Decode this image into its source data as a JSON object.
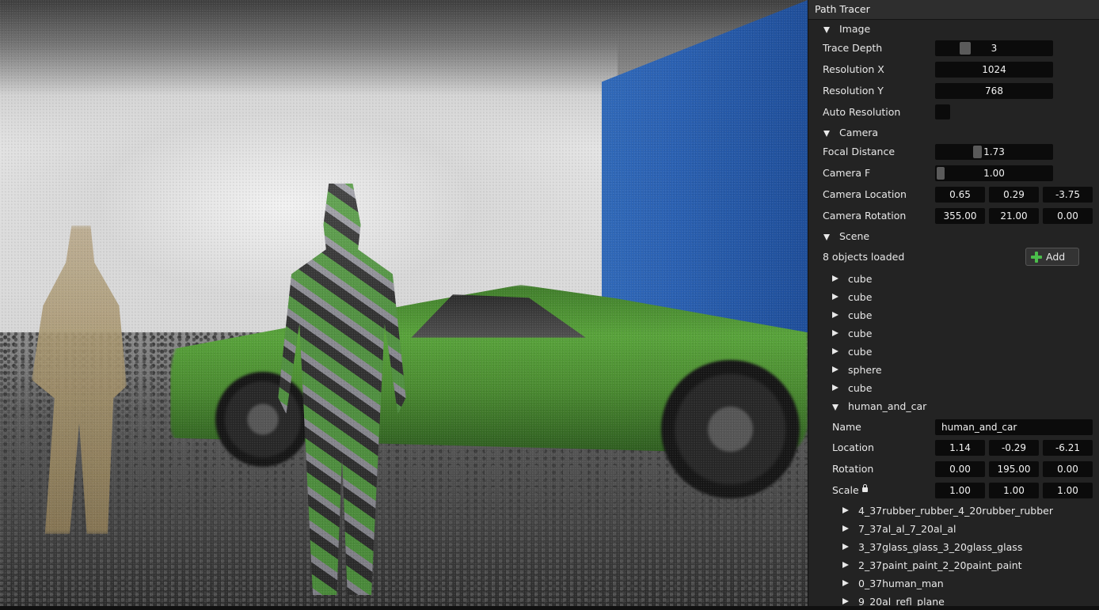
{
  "panel": {
    "title": "Path Tracer",
    "image": {
      "header": "Image",
      "trace_depth": {
        "label": "Trace Depth",
        "value": "3"
      },
      "resolution_x": {
        "label": "Resolution X",
        "value": "1024"
      },
      "resolution_y": {
        "label": "Resolution Y",
        "value": "768"
      },
      "auto_resolution": {
        "label": "Auto Resolution",
        "checked": false
      }
    },
    "camera": {
      "header": "Camera",
      "focal_distance": {
        "label": "Focal Distance",
        "value": "1.73"
      },
      "camera_f": {
        "label": "Camera F",
        "value": "1.00"
      },
      "location": {
        "label": "Camera Location",
        "values": [
          "0.65",
          "0.29",
          "-3.75"
        ]
      },
      "rotation": {
        "label": "Camera Rotation",
        "values": [
          "355.00",
          "21.00",
          "0.00"
        ]
      }
    },
    "scene": {
      "header": "Scene",
      "status": "8 objects loaded",
      "add_label": "Add",
      "objects": [
        "cube",
        "cube",
        "cube",
        "cube",
        "cube",
        "sphere",
        "cube"
      ],
      "expanded": {
        "label": "human_and_car",
        "name": {
          "label": "Name",
          "value": "human_and_car"
        },
        "location": {
          "label": "Location",
          "values": [
            "1.14",
            "-0.29",
            "-6.21"
          ]
        },
        "rotation": {
          "label": "Rotation",
          "values": [
            "0.00",
            "195.00",
            "0.00"
          ]
        },
        "scale": {
          "label": "Scale",
          "values": [
            "1.00",
            "1.00",
            "1.00"
          ]
        },
        "children": [
          "4_37rubber_rubber_4_20rubber_rubber",
          "7_37al_al_7_20al_al",
          "3_37glass_glass_3_20glass_glass",
          "2_37paint_paint_2_20paint_paint",
          "0_37human_man",
          "9_20al_refl_plane"
        ]
      }
    }
  },
  "colors": {
    "panel_bg": "#232323",
    "field_bg": "#0b0b0b",
    "add_icon": "#4bbd4b",
    "wall_blue": "#2a61b3",
    "car_green": "#58a33a"
  }
}
